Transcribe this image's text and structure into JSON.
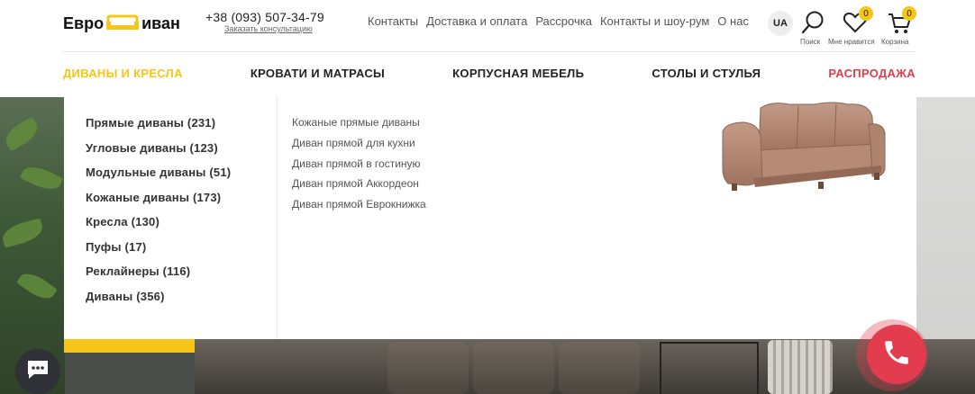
{
  "brand": {
    "logo_left": "Евро",
    "logo_right": "иван",
    "accent_color": "#f5c518",
    "sale_color": "#e23c4e"
  },
  "contact": {
    "phone": "+38 (093) 507-34-79",
    "consult_link": "Заказать консультацию"
  },
  "top_nav": [
    {
      "label": "Контакты"
    },
    {
      "label": "Доставка и оплата"
    },
    {
      "label": "Рассрочка"
    },
    {
      "label": "Контакты и шоу-рум"
    },
    {
      "label": "О нас"
    }
  ],
  "tools": {
    "lang": "UA",
    "search_label": "Поиск",
    "wishlist_label": "Мне нравится",
    "wishlist_count": "0",
    "cart_label": "Корзина",
    "cart_count": "0"
  },
  "category_nav": [
    {
      "label": "ДИВАНЫ И КРЕСЛА",
      "active": true
    },
    {
      "label": "КРОВАТИ И МАТРАСЫ"
    },
    {
      "label": "КОРПУСНАЯ МЕБЕЛЬ"
    },
    {
      "label": "СТОЛЫ И СТУЛЬЯ"
    },
    {
      "label": "РАСПРОДАЖА",
      "sale": true
    }
  ],
  "dropdown": {
    "categories": [
      {
        "label": "Прямые диваны (231)"
      },
      {
        "label": "Угловые диваны (123)"
      },
      {
        "label": "Модульные диваны (51)"
      },
      {
        "label": "Кожаные диваны (173)"
      },
      {
        "label": "Кресла (130)"
      },
      {
        "label": "Пуфы (17)"
      },
      {
        "label": "Реклайнеры (116)"
      },
      {
        "label": "Диваны (356)"
      }
    ],
    "subcategories": [
      {
        "label": "Кожаные прямые диваны"
      },
      {
        "label": "Диван прямой для кухни"
      },
      {
        "label": "Диван прямой в гостиную"
      },
      {
        "label": "Диван прямой Аккордеон"
      },
      {
        "label": "Диван прямой Еврокнижка"
      }
    ],
    "image_icon": "sofa-image"
  },
  "floating": {
    "chat_icon": "chat-icon",
    "call_icon": "phone-icon"
  }
}
